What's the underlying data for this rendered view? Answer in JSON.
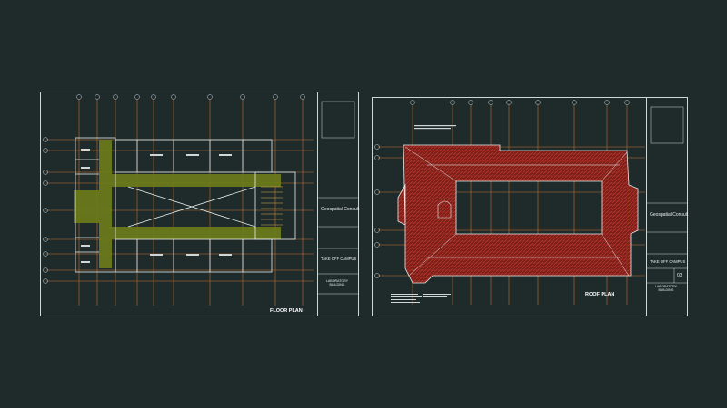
{
  "canvas": {
    "background": "#1f2b2b"
  },
  "colors": {
    "line": "#cfd6d6",
    "grid": "#e07a2e",
    "hatch": "#c33a2a",
    "roof_fill": "#7a1f1a",
    "floor_fill": "#6a7a1c",
    "wall": "#e8eeee"
  },
  "sheets": [
    {
      "title": "FLOOR PLAN",
      "title_block": {
        "company": "Geospatial Consult",
        "project": "TAKE OFF CAMPUS",
        "drawing": "LABORATORY BUILDING",
        "sheet_no": ""
      }
    },
    {
      "title": "ROOF PLAN",
      "title_block": {
        "company": "Geospatial Consult",
        "project": "TAKE OFF CAMPUS",
        "drawing": "LABORATORY BUILDING",
        "sheet_no": "03"
      }
    }
  ]
}
